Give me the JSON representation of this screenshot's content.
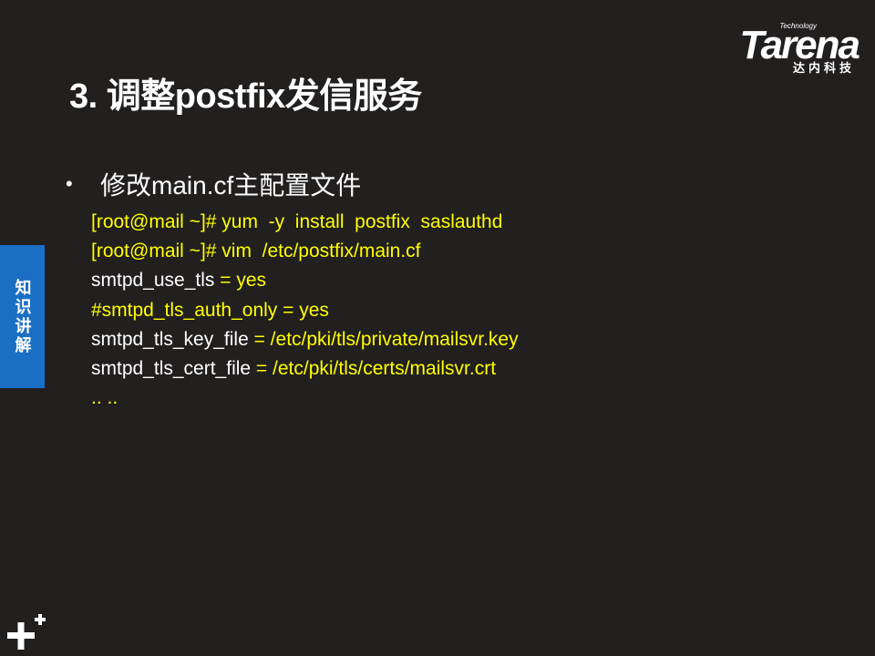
{
  "logo": {
    "sub": "Technology",
    "main": "Tarena",
    "cn": "达内科技"
  },
  "slide": {
    "title": "3. 调整postfix发信服务",
    "bullet": "修改main.cf主配置文件",
    "side_tab": "知识讲解"
  },
  "code": [
    {
      "segments": [
        {
          "text": "[root@mail ~]# yum  -y  install  postfix  saslauthd",
          "color": "yellow"
        }
      ]
    },
    {
      "segments": [
        {
          "text": "[root@mail ~]# vim  /etc/postfix/main.cf",
          "color": "yellow"
        }
      ]
    },
    {
      "segments": [
        {
          "text": "smtpd_use_tls",
          "color": "white"
        },
        {
          "text": " = yes",
          "color": "yellow"
        }
      ]
    },
    {
      "segments": [
        {
          "text": "#smtpd_tls_auth_only = yes",
          "color": "yellow"
        }
      ]
    },
    {
      "segments": [
        {
          "text": "smtpd_tls_key_file",
          "color": "white"
        },
        {
          "text": " = /etc/pki/tls/private/mailsvr.key",
          "color": "yellow"
        }
      ]
    },
    {
      "segments": [
        {
          "text": "smtpd_tls_cert_file",
          "color": "white"
        },
        {
          "text": " = /etc/pki/tls/certs/mailsvr.crt",
          "color": "yellow"
        }
      ]
    },
    {
      "segments": [
        {
          "text": ".. ..",
          "color": "yellow"
        }
      ]
    }
  ],
  "colors": {
    "background": "#221f1f",
    "accent_blue": "#1a6fc4",
    "code_yellow": "#ffff00"
  },
  "icons": {
    "corner": "plus-icon"
  }
}
